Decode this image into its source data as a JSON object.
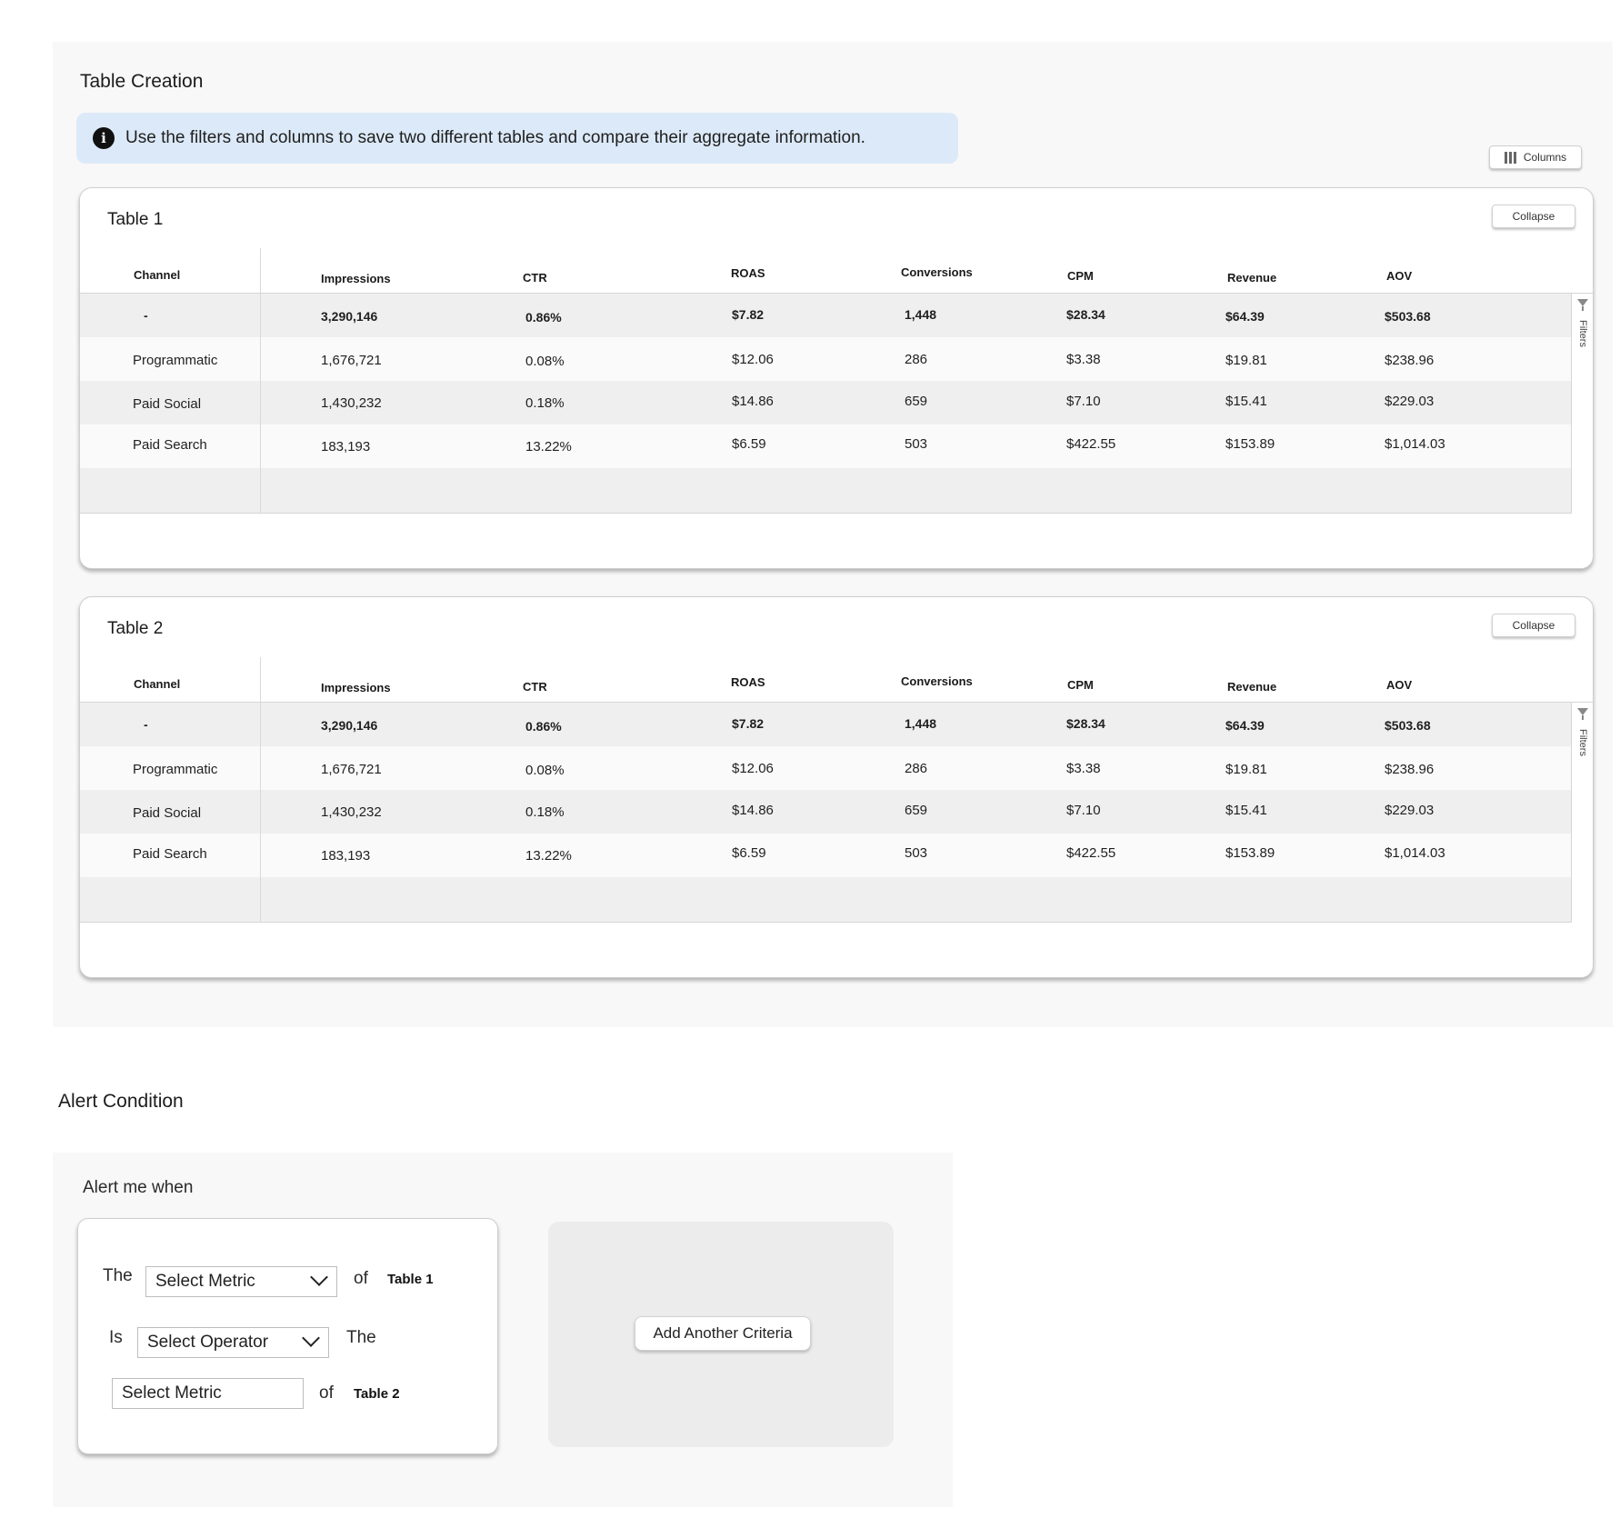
{
  "page": {
    "creation_title": "Table Creation",
    "info_message": "Use the filters and columns to save two different tables and compare their aggregate information.",
    "columns_button": "Columns",
    "accent_info_bg": "#dce9f8"
  },
  "table_headers": [
    "Channel",
    "Impressions",
    "CTR",
    "ROAS",
    "Conversions",
    "CPM",
    "Revenue",
    "AOV"
  ],
  "tables": [
    {
      "title": "Table 1",
      "collapse_label": "Collapse",
      "filters_label": "Filters",
      "rows": [
        [
          "-",
          "3,290,146",
          "0.86%",
          "$7.82",
          "1,448",
          "$28.34",
          "$64.39",
          "$503.68"
        ],
        [
          "Programmatic",
          "1,676,721",
          "0.08%",
          "$12.06",
          "286",
          "$3.38",
          "$19.81",
          "$238.96"
        ],
        [
          "Paid Social",
          "1,430,232",
          "0.18%",
          "$14.86",
          "659",
          "$7.10",
          "$15.41",
          "$229.03"
        ],
        [
          "Paid Search",
          "183,193",
          "13.22%",
          "$6.59",
          "503",
          "$422.55",
          "$153.89",
          "$1,014.03"
        ]
      ]
    },
    {
      "title": "Table 2",
      "collapse_label": "Collapse",
      "filters_label": "Filters",
      "rows": [
        [
          "-",
          "3,290,146",
          "0.86%",
          "$7.82",
          "1,448",
          "$28.34",
          "$64.39",
          "$503.68"
        ],
        [
          "Programmatic",
          "1,676,721",
          "0.08%",
          "$12.06",
          "286",
          "$3.38",
          "$19.81",
          "$238.96"
        ],
        [
          "Paid Social",
          "1,430,232",
          "0.18%",
          "$14.86",
          "659",
          "$7.10",
          "$15.41",
          "$229.03"
        ],
        [
          "Paid Search",
          "183,193",
          "13.22%",
          "$6.59",
          "503",
          "$422.55",
          "$153.89",
          "$1,014.03"
        ]
      ]
    }
  ],
  "alert": {
    "title": "Alert Condition",
    "lead": "Alert me when",
    "word_the": "The",
    "word_of": "of",
    "word_is": "Is",
    "word_the2": "The",
    "word_of2": "of",
    "table1_ref": "Table 1",
    "table2_ref": "Table 2",
    "metric_select_1": "Select Metric",
    "operator_select": "Select Operator",
    "metric_select_2": "Select Metric",
    "add_criteria": "Add Another Criteria"
  }
}
